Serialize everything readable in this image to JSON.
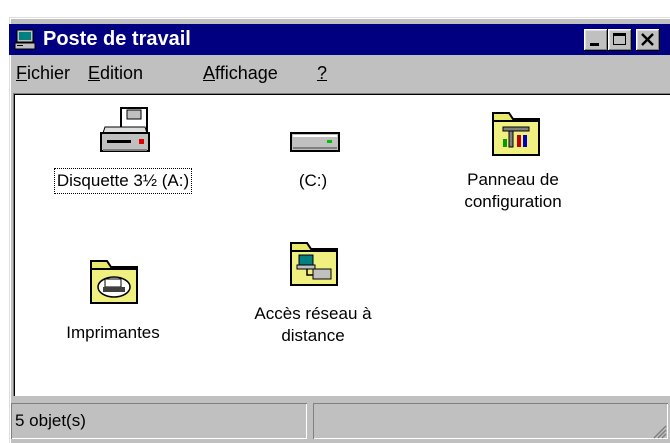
{
  "window": {
    "title": "Poste de travail",
    "title_icon": "my-computer-icon",
    "buttons": [
      "minimize-icon",
      "maximize-icon",
      "close-icon"
    ]
  },
  "menu": {
    "items": [
      {
        "accel": "F",
        "rest": "ichier"
      },
      {
        "accel": "E",
        "rest": "dition"
      },
      {
        "accel": "A",
        "rest": "ffichage"
      },
      {
        "accel": "?",
        "rest": ""
      }
    ]
  },
  "icons": [
    {
      "name": "floppy-drive-icon",
      "label": "Disquette 3½ (A:)",
      "selected": true
    },
    {
      "name": "hard-drive-icon",
      "label": "(C:)",
      "selected": false
    },
    {
      "name": "control-panel-folder-icon",
      "label_lines": [
        "Panneau de",
        "configuration"
      ],
      "selected": false
    },
    {
      "name": "printers-folder-icon",
      "label": "Imprimantes",
      "selected": false
    },
    {
      "name": "dial-up-networking-folder-icon",
      "label_lines": [
        "Accès réseau à",
        "distance"
      ],
      "selected": false
    }
  ],
  "status": {
    "objects_text": "5 objet(s)"
  },
  "colors": {
    "title_bg": "#000080",
    "face": "#c0c0c0",
    "folder": "#e8e86a"
  }
}
